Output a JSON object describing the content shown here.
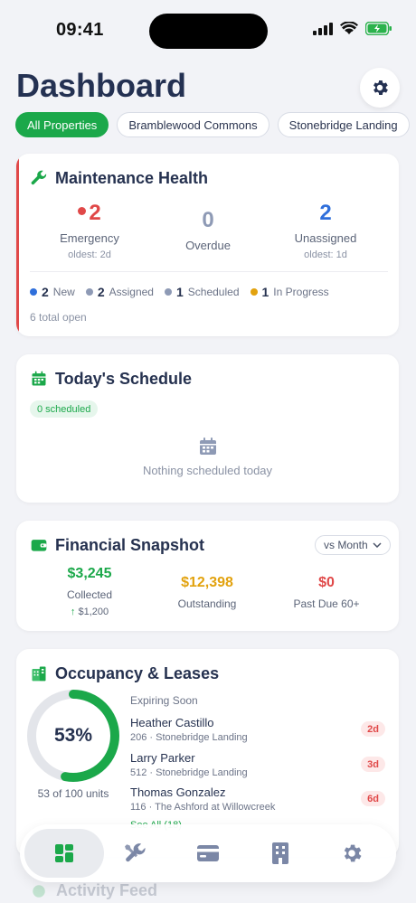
{
  "status_bar": {
    "time": "09:41"
  },
  "header": {
    "title": "Dashboard"
  },
  "property_filters": [
    "All Properties",
    "Bramblewood Commons",
    "Stonebridge Landing"
  ],
  "maintenance": {
    "title": "Maintenance Health",
    "emergency": {
      "value": "2",
      "label": "Emergency",
      "sub": "oldest: 2d"
    },
    "overdue": {
      "value": "0",
      "label": "Overdue"
    },
    "unassigned": {
      "value": "2",
      "label": "Unassigned",
      "sub": "oldest: 1d"
    },
    "statuses": [
      {
        "count": "2",
        "label": "New",
        "color": "#2f6fdb"
      },
      {
        "count": "2",
        "label": "Assigned",
        "color": "#8e9ab5"
      },
      {
        "count": "1",
        "label": "Scheduled",
        "color": "#8e9ab5"
      },
      {
        "count": "1",
        "label": "In Progress",
        "color": "#e2a20e"
      }
    ],
    "total_open": "6 total open"
  },
  "schedule": {
    "title": "Today's Schedule",
    "badge": "0 scheduled",
    "empty_text": "Nothing scheduled today"
  },
  "financial": {
    "title": "Financial Snapshot",
    "compare_select": "vs Month",
    "collected": {
      "value": "$3,245",
      "label": "Collected",
      "change": "$1,200"
    },
    "outstanding": {
      "value": "$12,398",
      "label": "Outstanding"
    },
    "past_due": {
      "value": "$0",
      "label": "Past Due 60+"
    }
  },
  "occupancy": {
    "title": "Occupancy & Leases",
    "percent": "53%",
    "percent_value": 0.53,
    "units": "53 of 100 units",
    "expiring_title": "Expiring Soon",
    "leases": [
      {
        "name": "Heather Castillo",
        "unit": "206 · Stonebridge Landing",
        "days": "2d"
      },
      {
        "name": "Larry Parker",
        "unit": "512 · Stonebridge Landing",
        "days": "3d"
      },
      {
        "name": "Thomas Gonzalez",
        "unit": "116 · The Ashford at Willowcreek",
        "days": "6d"
      }
    ],
    "see_all": "See All (18)"
  },
  "activity": {
    "title": "Activity Feed"
  },
  "colors": {
    "accent": "#1ba84a",
    "danger": "#e04848",
    "warning": "#e2a20e",
    "info": "#2f6fdb"
  },
  "tabbar": {
    "icons": [
      "dashboard-icon",
      "tools-icon",
      "payments-icon",
      "building-icon",
      "gear-icon"
    ]
  }
}
